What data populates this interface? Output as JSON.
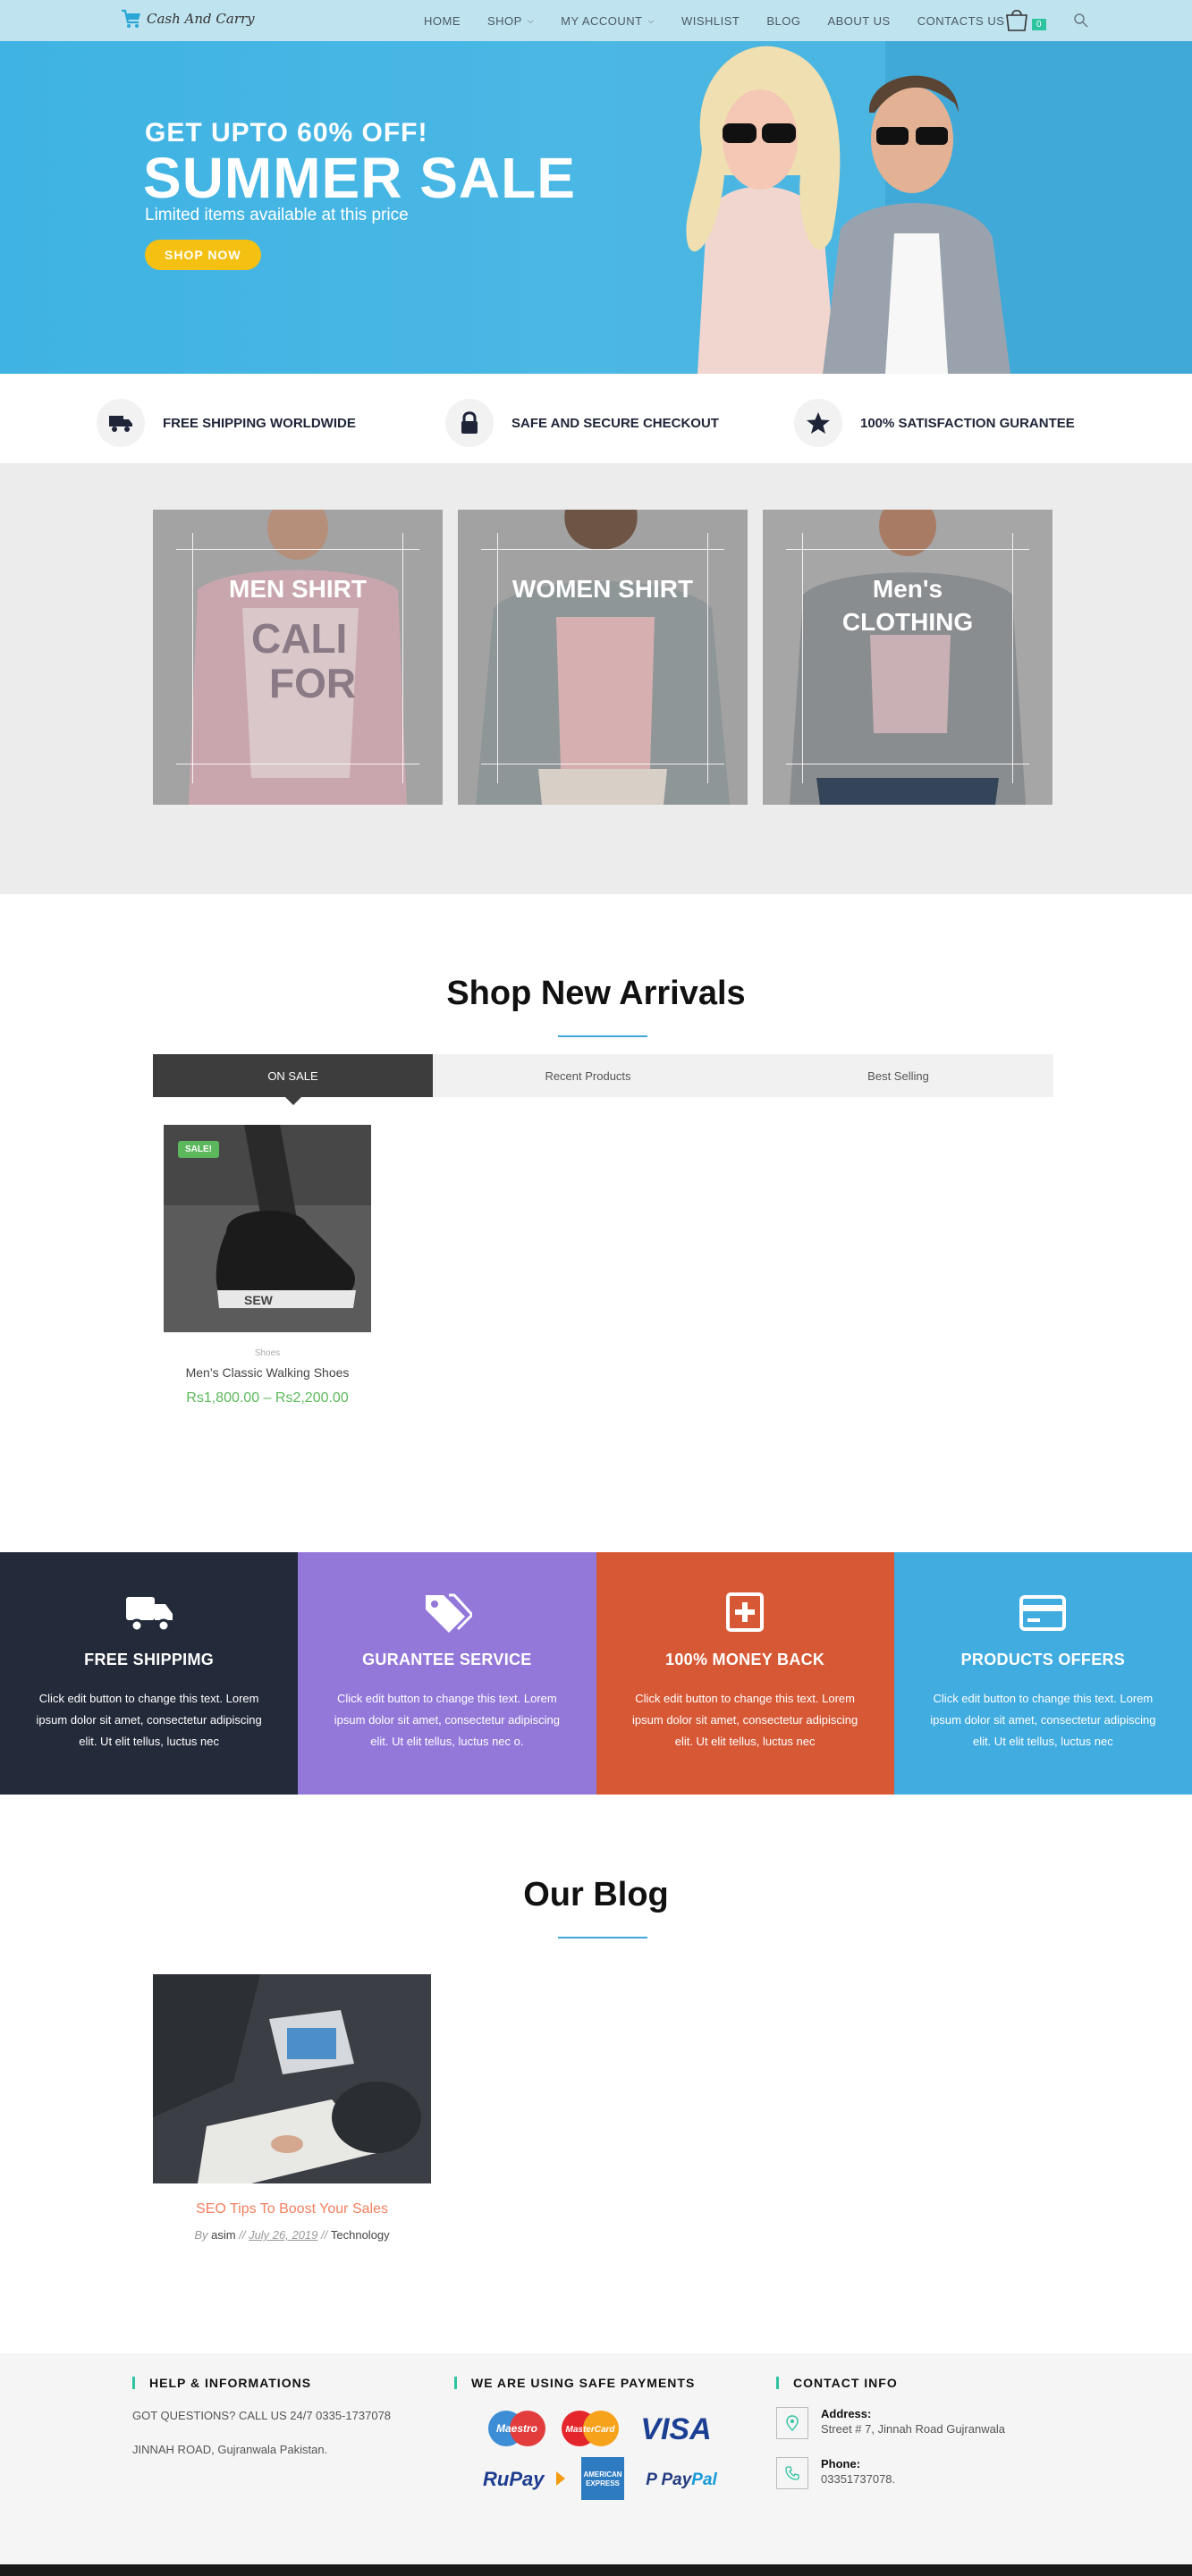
{
  "header": {
    "logo_text": "Cash And Carry",
    "nav": [
      {
        "label": "HOME"
      },
      {
        "label": "SHOP",
        "has_dropdown": true
      },
      {
        "label": "MY ACCOUNT",
        "has_dropdown": true
      },
      {
        "label": "WISHLIST"
      },
      {
        "label": "BLOG"
      },
      {
        "label": "ABOUT US"
      },
      {
        "label": "CONTACTS US"
      }
    ],
    "cart_count": "0"
  },
  "hero": {
    "kicker": "GET UPTO 60% OFF!",
    "title": "SUMMER SALE",
    "subtitle": "Limited items available at this price",
    "button": "SHOP NOW",
    "background": "#45b5e3",
    "button_color": "#f4c012"
  },
  "features": [
    {
      "icon": "truck-icon",
      "label": "FREE SHIPPING WORLDWIDE"
    },
    {
      "icon": "lock-icon",
      "label": "SAFE AND SECURE CHECKOUT"
    },
    {
      "icon": "star-icon",
      "label": "100% SATISFACTION GURANTEE"
    }
  ],
  "categories": [
    {
      "title": "MEN SHIRT"
    },
    {
      "title": "WOMEN SHIRT"
    },
    {
      "title": "Men's CLOTHING"
    }
  ],
  "new_arrivals": {
    "title": "Shop New Arrivals",
    "tabs": [
      "ON SALE",
      "Recent Products",
      "Best Selling"
    ],
    "active_tab": "ON SALE",
    "products": [
      {
        "badge": "SALE!",
        "category": "Shoes",
        "name": "Men’s Classic Walking Shoes",
        "price": "Rs1,800.00 – Rs2,200.00"
      }
    ]
  },
  "services": [
    {
      "icon": "truck-icon",
      "title": "FREE SHIPPIMG",
      "text": "Click edit button to change this text. Lorem ipsum dolor sit amet, consectetur adipiscing elit. Ut elit tellus, luctus nec",
      "color": "#232a39"
    },
    {
      "icon": "tag-icon",
      "title": "GURANTEE SERVICE",
      "text": "Click edit button to change this text. Lorem ipsum dolor sit amet, consectetur adipiscing elit. Ut elit tellus, luctus nec o.",
      "color": "#9378da"
    },
    {
      "icon": "plus-square-icon",
      "title": "100% MONEY BACK",
      "text": "Click edit button to change this text. Lorem ipsum dolor sit amet, consectetur adipiscing elit. Ut elit tellus, luctus nec",
      "color": "#d75835"
    },
    {
      "icon": "credit-card-icon",
      "title": "PRODUCTS OFFERS",
      "text": "Click edit button to change this text. Lorem ipsum dolor sit amet, consectetur adipiscing elit. Ut elit tellus, luctus nec",
      "color": "#41ace0"
    }
  ],
  "blog": {
    "title": "Our Blog",
    "posts": [
      {
        "title": "SEO Tips To Boost Your Sales",
        "by": "By",
        "author": "asim",
        "sep": "//",
        "date": "July 26, 2019",
        "category": "Technology"
      }
    ]
  },
  "footer": {
    "help": {
      "heading": "HELP & INFORMATIONS",
      "line1": "GOT QUESTIONS? CALL US 24/7 0335-1737078",
      "line2": "JINNAH ROAD, Gujranwala Pakistan."
    },
    "payments": {
      "heading": "WE ARE USING SAFE PAYMENTS",
      "logos": [
        "Maestro",
        "MasterCard",
        "VISA",
        "RuPay",
        "American Express",
        "PayPal"
      ]
    },
    "contact": {
      "heading": "CONTACT INFO",
      "address_label": "Address:",
      "address": "Street # 7, Jinnah Road Gujranwala",
      "phone_label": "Phone:",
      "phone": "03351737078."
    }
  }
}
